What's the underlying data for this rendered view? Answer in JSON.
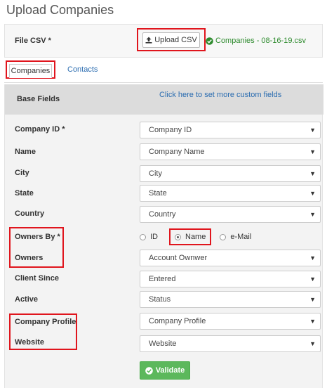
{
  "page": {
    "title": "Upload Companies"
  },
  "file": {
    "label": "File CSV *",
    "upload_label": "Upload CSV",
    "upload_icon": "upload-icon",
    "status_icon": "check-circle-icon",
    "status_text": "Companies - 08-16-19.csv",
    "status_color": "#2e8b2e"
  },
  "tabs": [
    {
      "label": "Companies",
      "active": true
    },
    {
      "label": "Contacts",
      "active": false
    }
  ],
  "panel": {
    "title": "Base Fields",
    "custom_link": "Click here to set more custom fields"
  },
  "fields": {
    "company_id": {
      "label": "Company ID *",
      "value": "Company ID"
    },
    "name": {
      "label": "Name",
      "value": "Company Name"
    },
    "city": {
      "label": "City",
      "value": "City"
    },
    "state": {
      "label": "State",
      "value": "State"
    },
    "country": {
      "label": "Country",
      "value": "Country"
    },
    "owners_by": {
      "label": "Owners By *",
      "options": [
        {
          "label": "ID",
          "selected": false
        },
        {
          "label": "Name",
          "selected": true
        },
        {
          "label": "e-Mail",
          "selected": false
        }
      ]
    },
    "owners": {
      "label": "Owners",
      "value": "Account Ownwer"
    },
    "client_since": {
      "label": "Client Since",
      "value": "Entered"
    },
    "active": {
      "label": "Active",
      "value": "Status"
    },
    "company_profile": {
      "label": "Company Profile",
      "value": "Company Profile"
    },
    "website": {
      "label": "Website",
      "value": "Website"
    }
  },
  "validate": {
    "label": "Validate",
    "icon": "check-circle-icon",
    "color": "#5cb85c"
  },
  "highlight_color": "#e0151d",
  "link_color": "#2a6cb0"
}
